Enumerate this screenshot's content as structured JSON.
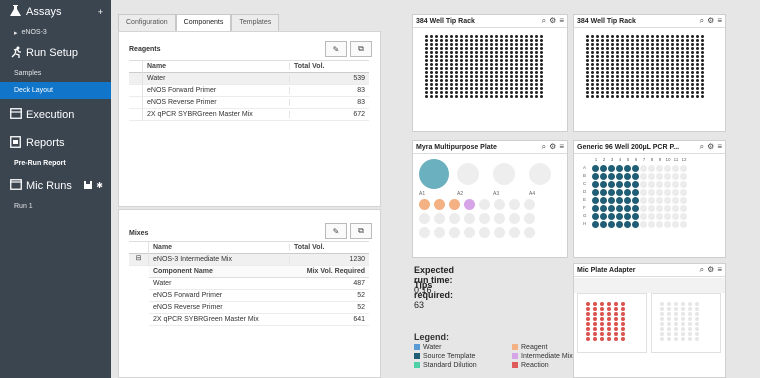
{
  "sidebar": {
    "assays_label": "Assays",
    "assay_item": "eNOS-3",
    "run_setup_label": "Run Setup",
    "samples_label": "Samples",
    "deck_layout_label": "Deck Layout",
    "execution_label": "Execution",
    "reports_label": "Reports",
    "pre_run_report_label": "Pre-Run Report",
    "mic_runs_label": "Mic Runs",
    "run1_label": "Run 1"
  },
  "tabs": [
    "Configuration",
    "Components",
    "Templates"
  ],
  "reagents": {
    "title": "Reagents",
    "col_name": "Name",
    "col_vol": "Total Vol.",
    "rows": [
      {
        "name": "Water",
        "vol": "539"
      },
      {
        "name": "eNOS Forward Primer",
        "vol": "83"
      },
      {
        "name": "eNOS Reverse Primer",
        "vol": "83"
      },
      {
        "name": "2X qPCR SYBRGreen Master Mix",
        "vol": "672"
      }
    ]
  },
  "mixes": {
    "title": "Mixes",
    "col_name": "Name",
    "col_vol": "Total Vol.",
    "mix_name": "eNOS-3 Intermediate Mix",
    "mix_vol": "1230",
    "sub_col_name": "Component Name",
    "sub_col_vol": "Mix Vol. Required",
    "rows": [
      {
        "name": "Water",
        "vol": "487"
      },
      {
        "name": "eNOS Forward Primer",
        "vol": "52"
      },
      {
        "name": "eNOS Reverse Primer",
        "vol": "52"
      },
      {
        "name": "2X qPCR SYBRGreen Master Mix",
        "vol": "641"
      }
    ]
  },
  "deck": {
    "rack1_title": "384 Well Tip Rack",
    "rack2_title": "384 Well Tip Rack",
    "myra_title": "Myra Multipurpose Plate",
    "pcr_title": "Generic 96 Well 200µL PCR P...",
    "mic_title": "Mic Plate Adapter",
    "myra_labels": [
      "A1",
      "A2",
      "A3",
      "A4"
    ],
    "pcr_cols": [
      "1",
      "2",
      "3",
      "4",
      "5",
      "6",
      "7",
      "8",
      "9",
      "10",
      "11",
      "12"
    ],
    "pcr_rows": [
      "A",
      "B",
      "C",
      "D",
      "E",
      "F",
      "G",
      "H"
    ]
  },
  "run": {
    "time_label": "Expected run time:",
    "time_value": "0:16",
    "tips_label": "Tips required:",
    "tips_value": "63"
  },
  "legend": {
    "title": "Legend:",
    "items": [
      {
        "label": "Water",
        "color": "#5b9bd5"
      },
      {
        "label": "Reagent",
        "color": "#f4b183"
      },
      {
        "label": "Source Template",
        "color": "#1f5e74"
      },
      {
        "label": "Intermediate Mix",
        "color": "#d6a5e8"
      },
      {
        "label": "Standard Dilution",
        "color": "#4fd1a8"
      },
      {
        "label": "Reaction",
        "color": "#e05a5a"
      }
    ]
  }
}
